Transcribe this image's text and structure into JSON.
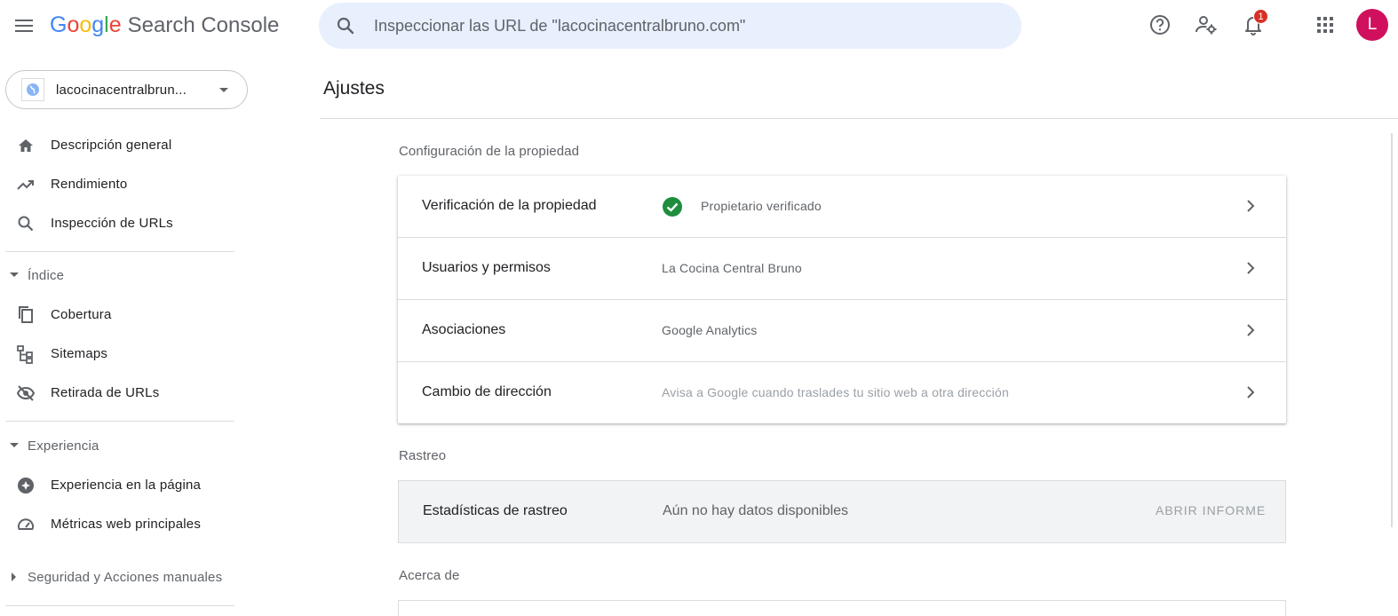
{
  "header": {
    "logo_google": [
      "G",
      "o",
      "o",
      "g",
      "l",
      "e"
    ],
    "logo_colors": [
      "#4285f4",
      "#ea4335",
      "#fbbc05",
      "#4285f4",
      "#34a853",
      "#ea4335"
    ],
    "logo_product": "Search Console",
    "search_placeholder": "Inspeccionar las URL de \"lacocinacentralbruno.com\"",
    "notifications_count": "1",
    "avatar_letter": "L",
    "icons": [
      "menu-icon",
      "search-icon",
      "help-icon",
      "manage-users-icon",
      "bell-icon",
      "apps-icon"
    ]
  },
  "sidebar": {
    "property": "lacocinacentralbrun...",
    "items": [
      {
        "label": "Descripción general",
        "icon": "home-icon"
      },
      {
        "label": "Rendimiento",
        "icon": "trending-up-icon"
      },
      {
        "label": "Inspección de URLs",
        "icon": "search-icon"
      }
    ],
    "index_section": "Índice",
    "index_items": [
      {
        "label": "Cobertura",
        "icon": "copy-icon"
      },
      {
        "label": "Sitemaps",
        "icon": "sitemap-icon"
      },
      {
        "label": "Retirada de URLs",
        "icon": "eye-off-icon"
      }
    ],
    "experience_section": "Experiencia",
    "experience_items": [
      {
        "label": "Experiencia en la página",
        "icon": "plus-circle-icon"
      },
      {
        "label": "Métricas web principales",
        "icon": "speed-icon"
      }
    ],
    "security_section": "Seguridad y Acciones manuales"
  },
  "main": {
    "title": "Ajustes",
    "property_config_label": "Configuración de la propiedad",
    "rows": [
      {
        "title": "Verificación de la propiedad",
        "value": "Propietario verificado"
      },
      {
        "title": "Usuarios y permisos",
        "value": "La Cocina Central Bruno"
      },
      {
        "title": "Asociaciones",
        "value": "Google Analytics"
      },
      {
        "title": "Cambio de dirección",
        "value": "Avisa a Google cuando traslades tu sitio web a otra dirección"
      }
    ],
    "crawl_label": "Rastreo",
    "crawl_row": {
      "title": "Estadísticas de rastreo",
      "value": "Aún no hay datos disponibles",
      "button": "ABRIR INFORME"
    },
    "about_label": "Acerca de"
  },
  "colors": {
    "accent": "#1a73e8",
    "verified": "#1e8e3e",
    "avatar": "#d0105c",
    "badge": "#d93025"
  }
}
